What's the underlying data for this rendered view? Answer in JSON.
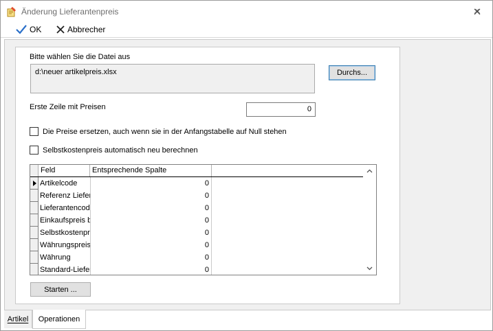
{
  "window": {
    "title": "Änderung Lieferantenpreis"
  },
  "toolbar": {
    "ok_label": "OK",
    "cancel_label": "Abbrecher"
  },
  "form": {
    "file_label": "Bitte wählen Sie die Datei aus",
    "file_path": "d:\\neuer artikelpreis.xlsx",
    "browse_label": "Durchs...",
    "first_row_label": "Erste Zeile mit Preisen",
    "first_row_value": "0",
    "replace_prices_label": "Die Preise ersetzen, auch wenn sie in der Anfangstabelle auf Null stehen",
    "replace_prices_checked": false,
    "recalc_cost_label": "Selbstkostenpreis automatisch neu berechnen",
    "recalc_cost_checked": false,
    "start_label": "Starten ..."
  },
  "grid": {
    "columns": [
      "Feld",
      "Entsprechende Spalte"
    ],
    "rows": [
      {
        "feld": "Artikelcode",
        "spalte": "0"
      },
      {
        "feld": "Referenz Lieferant",
        "spalte": "0"
      },
      {
        "feld": "Lieferantencode",
        "spalte": "0"
      },
      {
        "feld": "Einkaufspreis brutto",
        "spalte": "0"
      },
      {
        "feld": "Selbstkostenpreis",
        "spalte": "0"
      },
      {
        "feld": "Währungspreis",
        "spalte": "0"
      },
      {
        "feld": "Währung",
        "spalte": "0"
      },
      {
        "feld": "Standard-Lieferant",
        "spalte": "0"
      }
    ]
  },
  "tabs": [
    {
      "label": "Artikel",
      "active": false
    },
    {
      "label": "Operationen",
      "active": true
    }
  ],
  "colors": {
    "ok_check": "#2a6fc9",
    "focus_border": "#3c7fb1"
  }
}
